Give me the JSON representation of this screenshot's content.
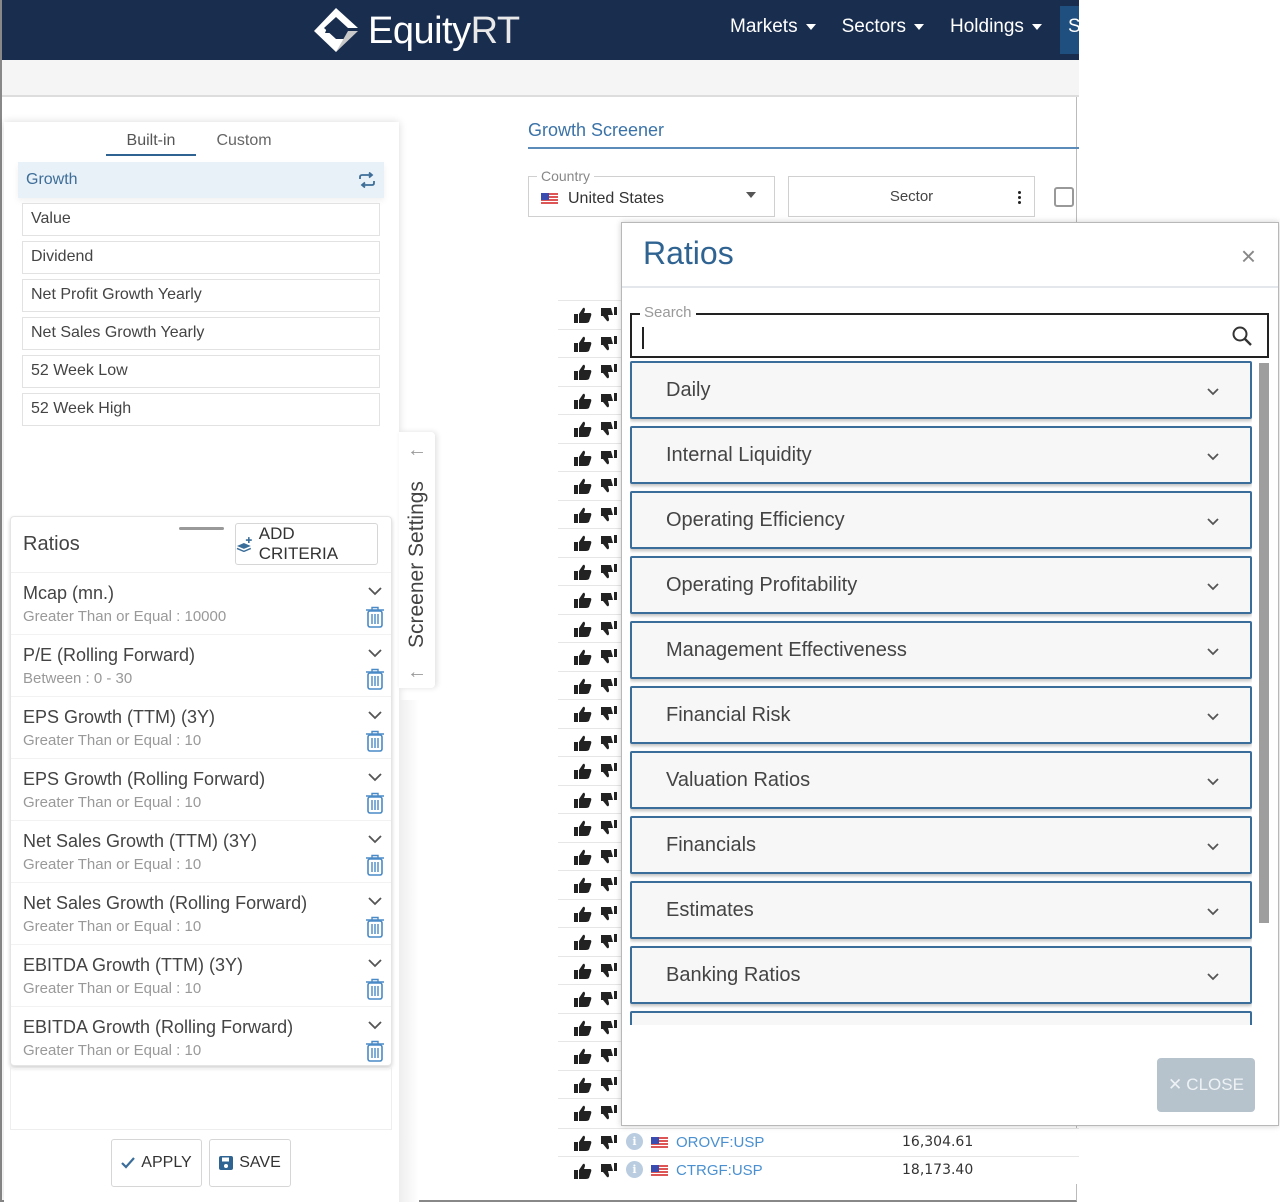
{
  "brand": {
    "name_prefix": "Equity",
    "name_suffix": "RT"
  },
  "nav": {
    "items": [
      {
        "label": "Markets"
      },
      {
        "label": "Sectors"
      },
      {
        "label": "Holdings"
      }
    ],
    "overflow_label": "S"
  },
  "left_panel": {
    "tabs": [
      {
        "label": "Built-in",
        "active": true
      },
      {
        "label": "Custom",
        "active": false
      }
    ],
    "presets": {
      "active": "Growth",
      "items": [
        "Value",
        "Dividend",
        "Net Profit Growth Yearly",
        "Net Sales Growth Yearly",
        "52 Week Low",
        "52 Week High"
      ]
    },
    "ratios": {
      "title": "Ratios",
      "add_criteria_label": "ADD CRITERIA",
      "criteria": [
        {
          "name": "Mcap (mn.)",
          "condition": "Greater Than or Equal : 10000"
        },
        {
          "name": "P/E (Rolling Forward)",
          "condition": "Between : 0 - 30"
        },
        {
          "name": "EPS Growth (TTM) (3Y)",
          "condition": "Greater Than or Equal : 10"
        },
        {
          "name": "EPS Growth (Rolling Forward)",
          "condition": "Greater Than or Equal : 10"
        },
        {
          "name": "Net Sales Growth (TTM) (3Y)",
          "condition": "Greater Than or Equal : 10"
        },
        {
          "name": "Net Sales Growth (Rolling Forward)",
          "condition": "Greater Than or Equal : 10"
        },
        {
          "name": "EBITDA Growth (TTM) (3Y)",
          "condition": "Greater Than or Equal : 10"
        },
        {
          "name": "EBITDA Growth (Rolling Forward)",
          "condition": "Greater Than or Equal : 10"
        }
      ]
    },
    "apply_label": "APPLY",
    "save_label": "SAVE",
    "side_handle_label": "Screener Settings"
  },
  "main": {
    "title": "Growth Screener",
    "country": {
      "legend": "Country",
      "value": "United States"
    },
    "sector": {
      "label": "Sector"
    },
    "rows": [
      {
        "ticker": "OROVF:USP",
        "mcap": "16,304.61"
      },
      {
        "ticker": "CTRGF:USP",
        "mcap": "18,173.40"
      }
    ]
  },
  "modal": {
    "title": "Ratios",
    "search": {
      "legend": "Search",
      "value": "",
      "placeholder": ""
    },
    "categories": [
      "Daily",
      "Internal Liquidity",
      "Operating Efficiency",
      "Operating Profitability",
      "Management Effectiveness",
      "Financial Risk",
      "Valuation Ratios",
      "Financials",
      "Estimates",
      "Banking Ratios",
      ""
    ],
    "close_label": "CLOSE"
  },
  "colors": {
    "nav_bg": "#192d4f",
    "accent": "#2f6391",
    "link": "#4a90d0",
    "close_button": "#b6c3cd"
  }
}
